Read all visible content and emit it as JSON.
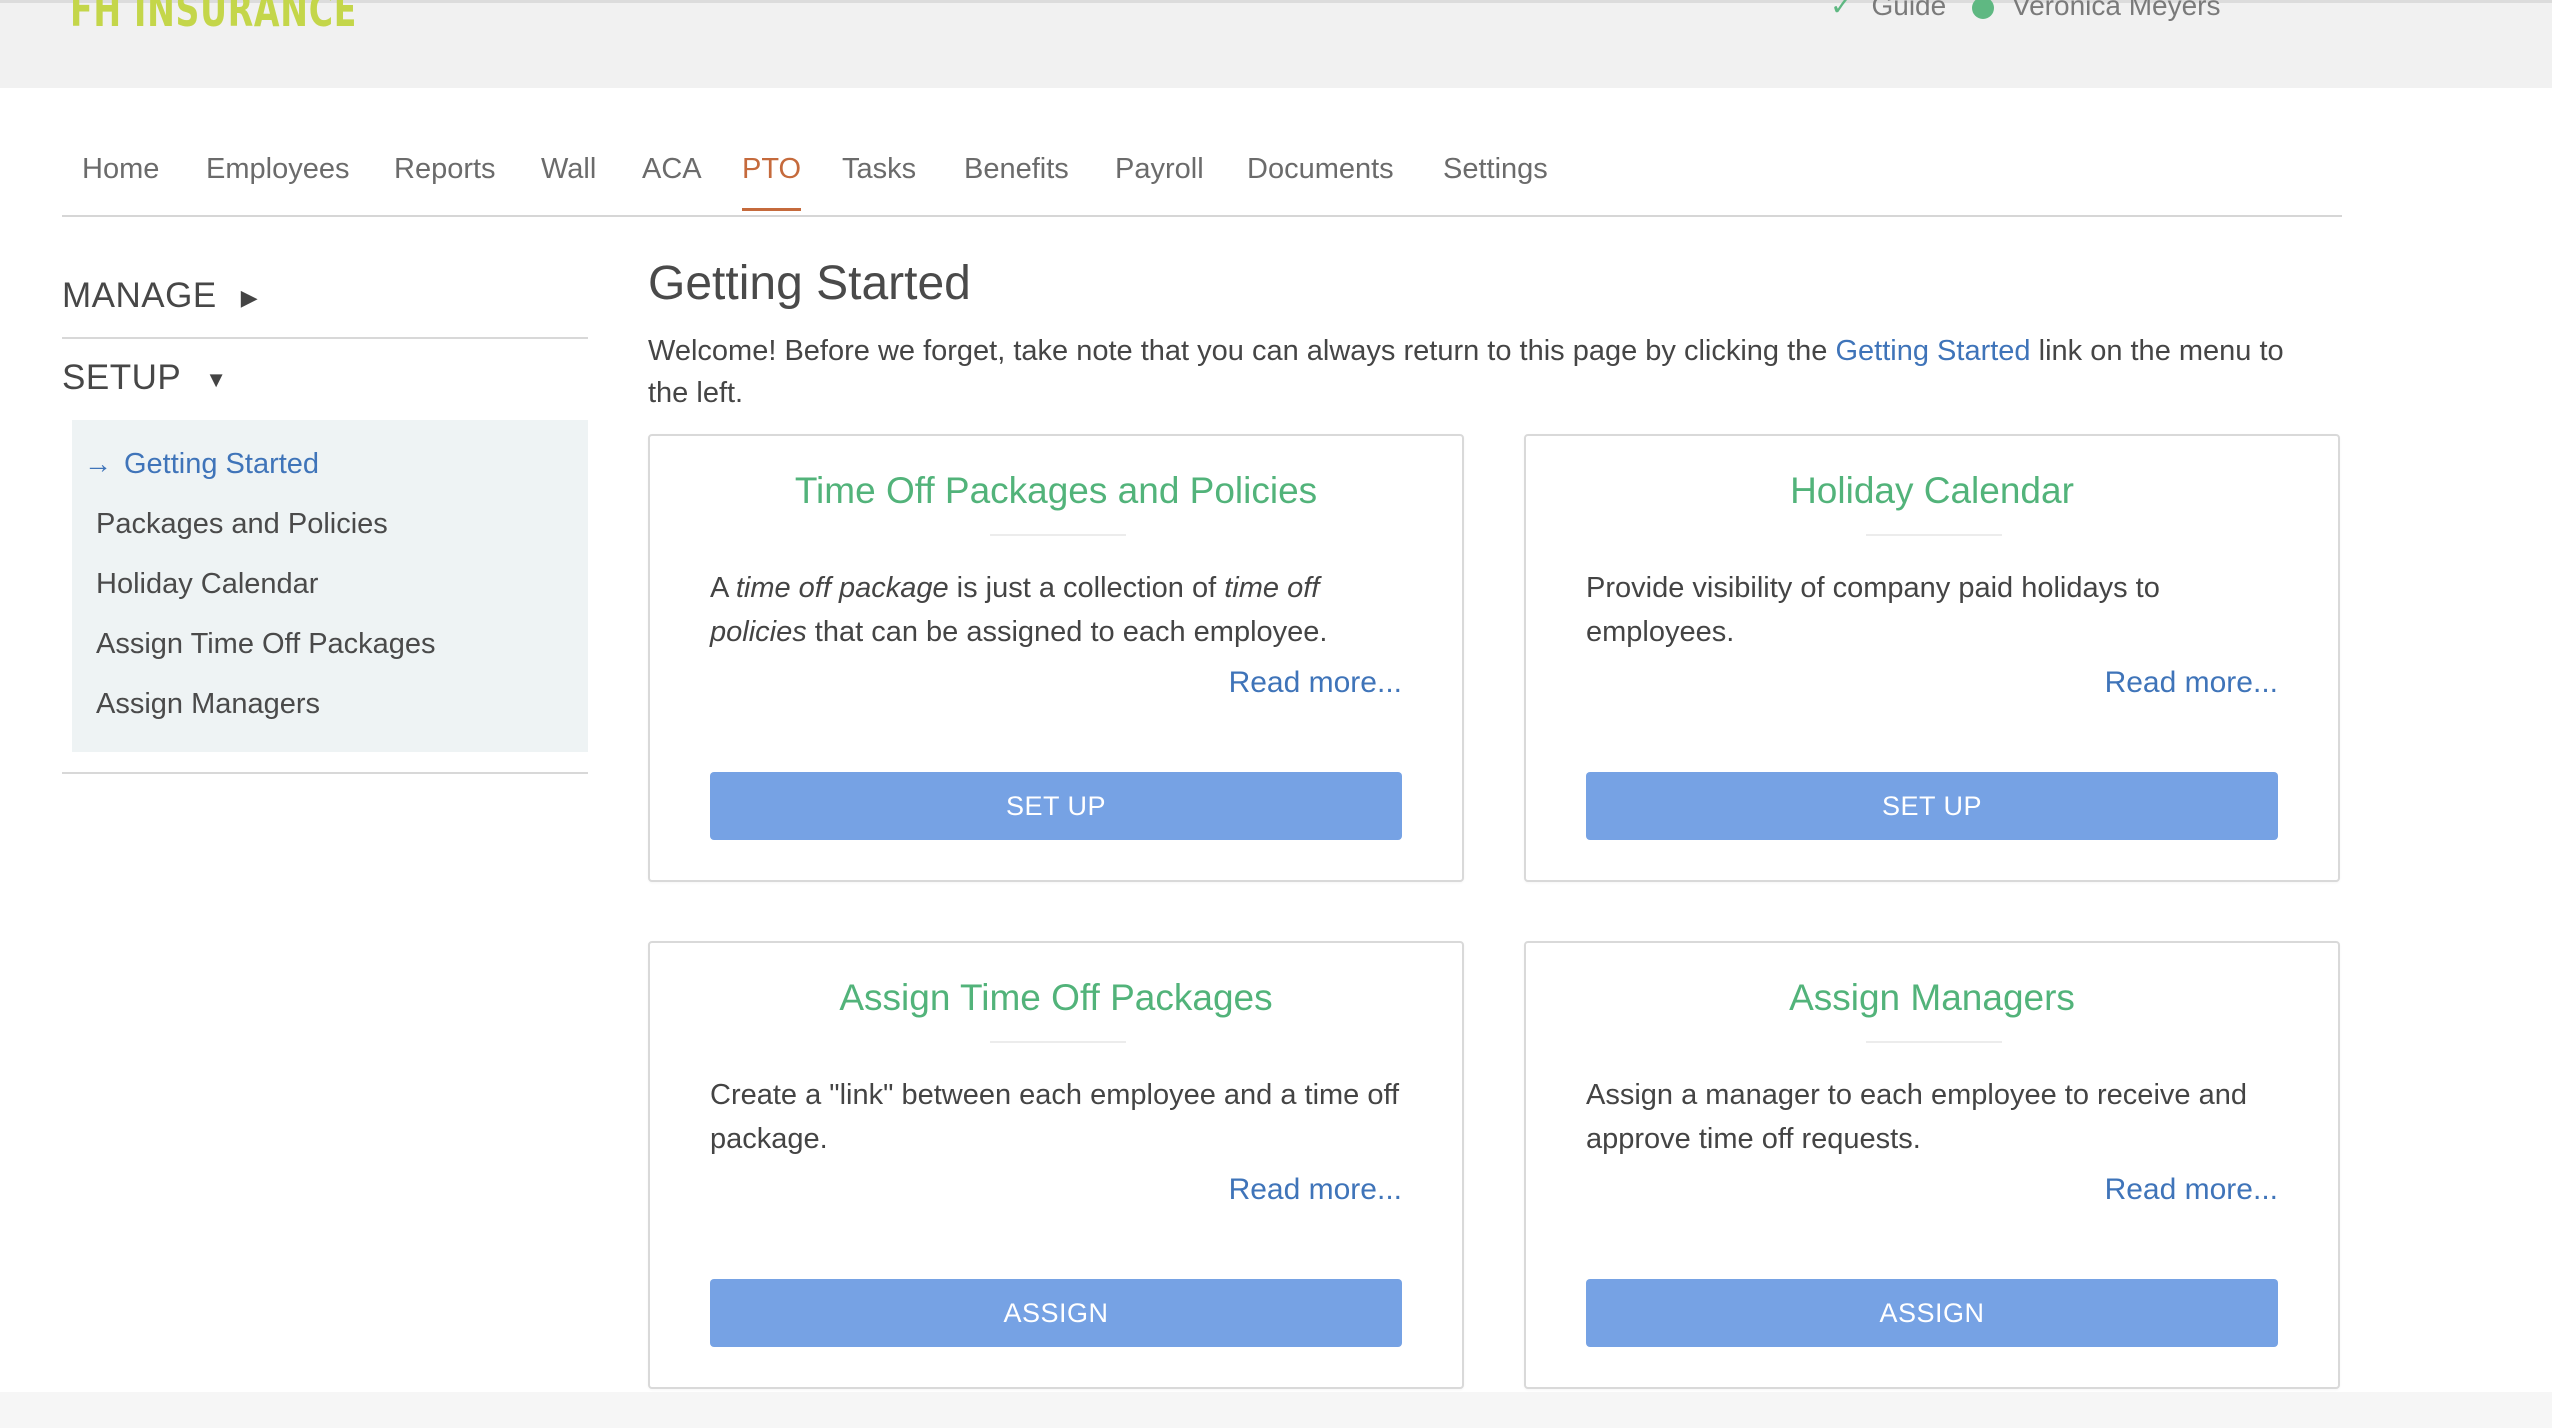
{
  "header": {
    "logo_text": "FH INSURANCE",
    "guide_label": "Guide",
    "user_name": "Veronica Meyers"
  },
  "nav": {
    "items": [
      {
        "label": "Home"
      },
      {
        "label": "Employees"
      },
      {
        "label": "Reports"
      },
      {
        "label": "Wall"
      },
      {
        "label": "ACA"
      },
      {
        "label": "PTO"
      },
      {
        "label": "Tasks"
      },
      {
        "label": "Benefits"
      },
      {
        "label": "Payroll"
      },
      {
        "label": "Documents"
      },
      {
        "label": "Settings"
      }
    ],
    "active": "PTO"
  },
  "sidebar": {
    "manage_label": "MANAGE",
    "setup_label": "SETUP",
    "items": [
      {
        "label": "Getting Started"
      },
      {
        "label": "Packages and Policies"
      },
      {
        "label": "Holiday Calendar"
      },
      {
        "label": "Assign Time Off Packages"
      },
      {
        "label": "Assign Managers"
      }
    ]
  },
  "main": {
    "title": "Getting Started",
    "welcome_before": "Welcome! Before we forget, take note that you can always return to this page by clicking the ",
    "welcome_link": "Getting Started",
    "welcome_after": " link on the menu to the left."
  },
  "cards": [
    {
      "title": "Time Off Packages and Policies",
      "desc_parts": [
        "A ",
        "time off package",
        " is just a collection of ",
        "time off policies",
        " that can be assigned to each employee."
      ],
      "read_more": "Read more...",
      "button": "SET UP"
    },
    {
      "title": "Holiday Calendar",
      "desc": "Provide visibility of company paid holidays to employees.",
      "read_more": "Read more...",
      "button": "SET UP"
    },
    {
      "title": "Assign Time Off Packages",
      "desc": "Create a \"link\" between each employee and a time off package.",
      "read_more": "Read more...",
      "button": "ASSIGN"
    },
    {
      "title": "Assign Managers",
      "desc": "Assign a manager to each employee to receive and approve time off requests.",
      "read_more": "Read more...",
      "button": "ASSIGN"
    }
  ]
}
